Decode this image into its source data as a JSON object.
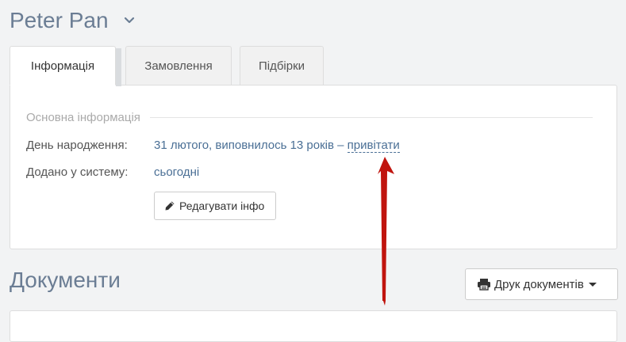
{
  "header": {
    "title": "Peter Pan",
    "dropdown_icon": "chevron-down-icon"
  },
  "tabs": [
    {
      "label": "Інформація",
      "active": true
    },
    {
      "label": "Замовлення",
      "active": false
    },
    {
      "label": "Підбірки",
      "active": false
    }
  ],
  "info": {
    "section_title": "Основна інформація",
    "birthday_label": "День народження:",
    "birthday_value": "31 лютого, виповнилось 13 років – ",
    "greet_link": "привітати",
    "added_label": "Додано у систему:",
    "added_value": "сьогодні",
    "edit_button": "Редагувати інфо",
    "edit_icon": "pencil-icon"
  },
  "documents": {
    "title": "Документи",
    "print_button": "Друк документів",
    "print_icon": "printer-icon"
  },
  "colors": {
    "link": "#4a6f95",
    "title": "#6b7d94",
    "annotation_arrow": "#c0140e"
  }
}
